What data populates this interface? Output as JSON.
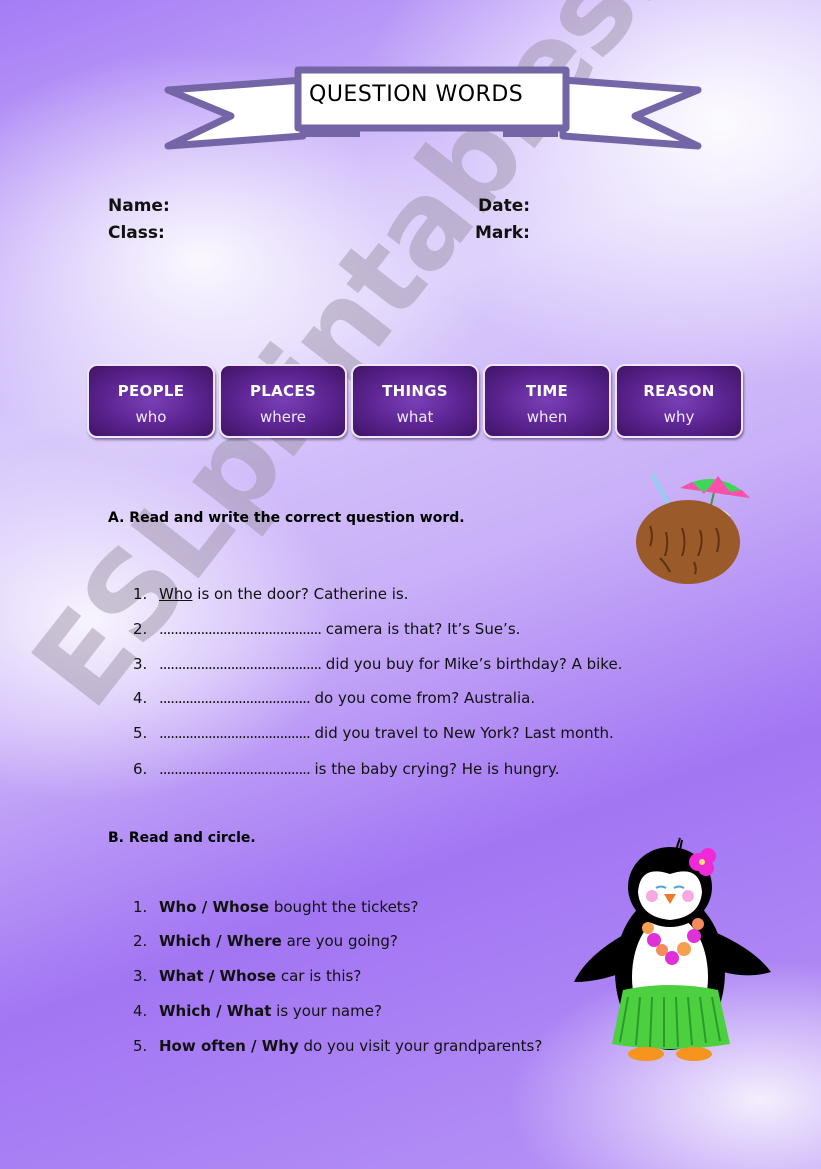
{
  "watermark": "ESLprintables.com",
  "title": "QUESTION WORDS",
  "info": {
    "name_label": "Name:",
    "class_label": "Class:",
    "date_label": "Date:",
    "mark_label": "Mark:"
  },
  "categories": [
    {
      "head": "PEOPLE",
      "word": "who"
    },
    {
      "head": "PLACES",
      "word": "where"
    },
    {
      "head": "THINGS",
      "word": "what"
    },
    {
      "head": "TIME",
      "word": "when"
    },
    {
      "head": "REASON",
      "word": "why"
    }
  ],
  "section_a": {
    "title": "A. Read and write the correct question word.",
    "items": [
      {
        "num": "1.",
        "answer": "Who",
        "blank": "",
        "text": " is on the door? Catherine is."
      },
      {
        "num": "2.",
        "answer": "",
        "blank": "...........................................",
        "text": " camera is that? It’s Sue’s."
      },
      {
        "num": "3.",
        "answer": "",
        "blank": "...........................................",
        "text": " did you buy for Mike’s birthday? A bike."
      },
      {
        "num": "4.",
        "answer": "",
        "blank": "........................................",
        "text": " do you come from? Australia."
      },
      {
        "num": "5.",
        "answer": "",
        "blank": "........................................",
        "text": " did you travel to New York? Last month."
      },
      {
        "num": "6.",
        "answer": "",
        "blank": "........................................",
        "text": " is the baby crying? He is hungry."
      }
    ]
  },
  "section_b": {
    "title": "B.  Read and circle.",
    "items": [
      {
        "num": "1.",
        "options": "Who / Whose",
        "text": " bought the tickets?"
      },
      {
        "num": "2.",
        "options": "Which / Where",
        "text": " are you going?"
      },
      {
        "num": "3.",
        "options": "What  / Whose",
        "text": " car is this?"
      },
      {
        "num": "4.",
        "options": "Which  / What",
        "text": " is your name?"
      },
      {
        "num": "5.",
        "options": "How often / Why",
        "text": " do you visit your grandparents?"
      }
    ]
  },
  "illustrations": {
    "coconut": "coconut-drink-with-umbrella",
    "penguin": "hula-penguin"
  }
}
